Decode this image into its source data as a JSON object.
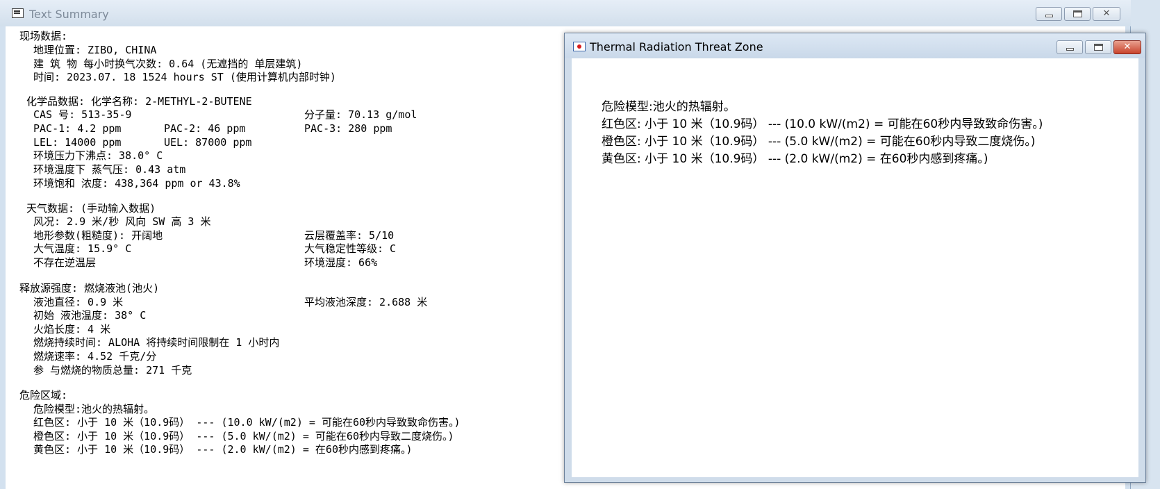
{
  "main_window": {
    "title": "Text Summary",
    "site_data": {
      "heading": "现场数据:",
      "location": "地理位置: ZIBO, CHINA",
      "building": "建 筑 物 每小时换气次数: 0.64 (无遮挡的  单层建筑)",
      "time": "时间: 2023.07. 18  1524 hours ST (使用计算机内部时钟)"
    },
    "chemical_data": {
      "heading": "化学品数据:     化学名称: 2-METHYL-2-BUTENE",
      "cas": "CAS 号: 513-35-9",
      "molecular_weight": "分子量: 70.13 g/mol",
      "pac1": "PAC-1: 4.2 ppm",
      "pac2": "PAC-2: 46 ppm",
      "pac3": "PAC-3: 280 ppm",
      "lel": "LEL: 14000 ppm",
      "uel": "UEL: 87000 ppm",
      "boiling_point": "环境压力下沸点: 38.0° C",
      "vapor_pressure": "环境温度下 蒸气压: 0.43 atm",
      "saturation": "环境饱和 浓度: 438,364 ppm or 43.8%"
    },
    "weather_data": {
      "heading": "天气数据: (手动输入数据)",
      "wind": "风况: 2.9  米/秒 风向 SW 高 3 米",
      "terrain": "地形参数(粗糙度): 开阔地",
      "cloud": "云层覆盖率:  5/10",
      "air_temp": "大气温度: 15.9° C",
      "stability": "大气稳定性等级: C",
      "inversion": "不存在逆温层",
      "humidity": "环境湿度: 66%"
    },
    "source_strength": {
      "heading": "释放源强度:   燃烧液池(池火)",
      "pool_diameter": "液池直径: 0.9 米",
      "avg_depth": "平均液池深度: 2.688 米",
      "initial_temp": "初始 液池温度: 38° C",
      "flame_length": "火焰长度: 4 米",
      "burn_duration": "燃烧持续时间:  ALOHA 将持续时间限制在 1 小时内",
      "burn_rate": "燃烧速率:  4.52 千克/分",
      "total_burned": "参 与燃烧的物质总量: 271 千克"
    },
    "threat_zone": {
      "heading": "危险区域:",
      "model": "危险模型:池火的热辐射。",
      "red": "红色区: 小于 10 米（10.9码） --- (10.0 kW/(m2) = 可能在60秒内导致致命伤害。)",
      "orange": "橙色区: 小于 10 米（10.9码） --- (5.0 kW/(m2) = 可能在60秒内导致二度烧伤。)",
      "yellow": "黄色区: 小于 10 米（10.9码） --- (2.0 kW/(m2) = 在60秒内感到疼痛。)"
    }
  },
  "threat_window": {
    "title": "Thermal Radiation Threat Zone",
    "model": "危险模型:池火的热辐射。",
    "red": "红色区: 小于 10 米（10.9码） --- (10.0 kW/(m2) = 可能在60秒内导致致命伤害。)",
    "orange": "橙色区: 小于 10 米（10.9码） --- (5.0 kW/(m2) = 可能在60秒内导致二度烧伤。)",
    "yellow": "黄色区: 小于 10 米（10.9码） --- (2.0 kW/(m2) = 在60秒内感到疼痛。)"
  },
  "icons": {
    "main_app": "text-summary-icon",
    "threat_app": "threat-zone-icon"
  }
}
